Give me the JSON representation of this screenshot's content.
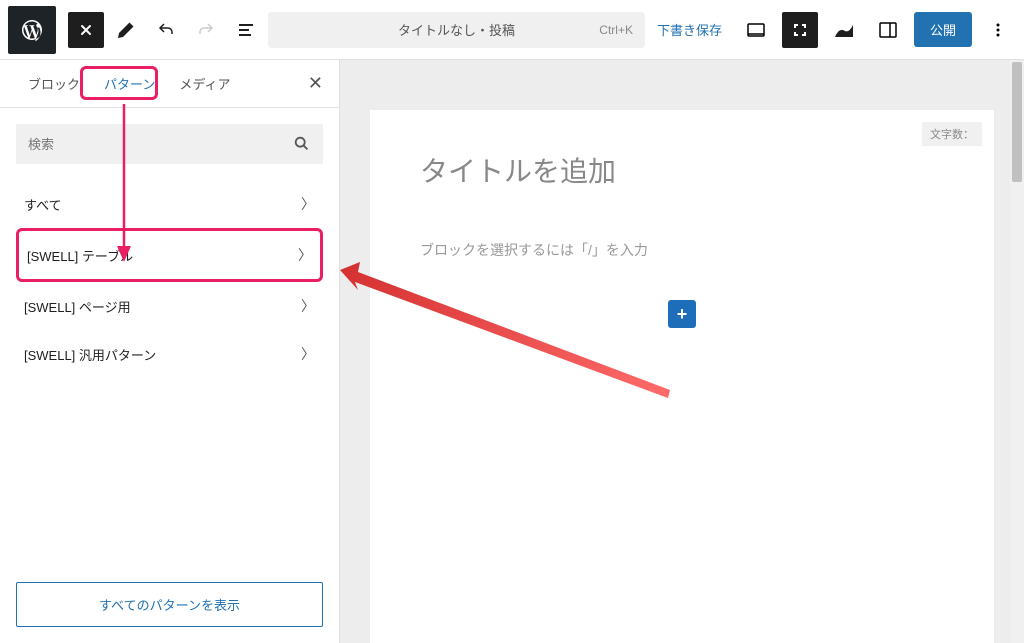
{
  "toolbar": {
    "doc_title": "タイトルなし・投稿",
    "doc_shortcut": "Ctrl+K",
    "save_draft": "下書き保存",
    "publish": "公開"
  },
  "sidebar": {
    "tabs": {
      "blocks": "ブロック",
      "patterns": "パターン",
      "media": "メディア"
    },
    "search_placeholder": "検索",
    "pattern_items": [
      {
        "label": "すべて"
      },
      {
        "label": "[SWELL] テーブル"
      },
      {
        "label": "[SWELL] ページ用"
      },
      {
        "label": "[SWELL] 汎用パターン"
      }
    ],
    "show_all": "すべてのパターンを表示"
  },
  "canvas": {
    "title_placeholder": "タイトルを追加",
    "word_count_label": "文字数：",
    "block_placeholder": "ブロックを選択するには「/」を入力"
  }
}
